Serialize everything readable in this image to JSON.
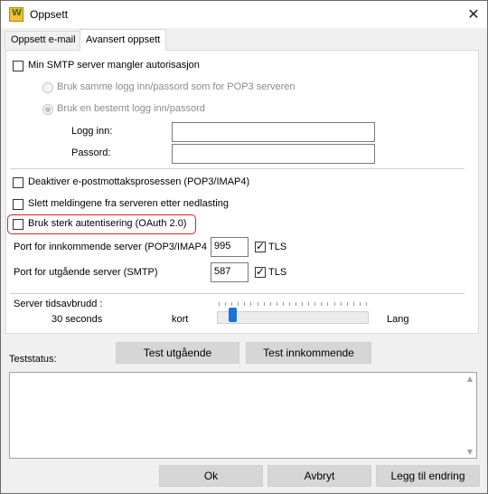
{
  "window": {
    "title": "Oppsett",
    "app_icon": "W",
    "close_glyph": "✕"
  },
  "tabs": [
    {
      "label": "Oppsett e-mail",
      "active": false
    },
    {
      "label": "Avansert oppsett",
      "active": true
    }
  ],
  "smtp": {
    "missing_auth_label": "Min SMTP server mangler autorisasjon",
    "missing_auth_checked": false,
    "same_login_label": "Bruk samme logg inn/passord som for POP3 serveren",
    "specific_login_label": "Bruk en bestemt logg inn/passord",
    "login_label": "Logg inn:",
    "login_value": "",
    "password_label": "Passord:",
    "password_value": ""
  },
  "options": {
    "disable_receive_label": "Deaktiver e-postmottaksprosessen (POP3/IMAP4)",
    "delete_messages_label": "Slett meldingene fra serveren etter nedlasting",
    "oauth_label": "Bruk sterk autentisering (OAuth 2.0)"
  },
  "ports": {
    "incoming_label": "Port for innkommende server (POP3/IMAP4",
    "incoming_value": "995",
    "incoming_tls_label": "TLS",
    "outgoing_label": "Port for utgående server (SMTP)",
    "outgoing_value": "587",
    "outgoing_tls_label": "TLS"
  },
  "timeout": {
    "label": "Server tidsavbrudd :",
    "value_text": "30 seconds",
    "short_label": "kort",
    "long_label": "Lang",
    "level_fraction": 0.07
  },
  "test": {
    "outgoing_button": "Test utgående",
    "incoming_button": "Test innkommende",
    "status_label": "Teststatus:",
    "status_text": ""
  },
  "footer": {
    "ok": "Ok",
    "cancel": "Avbryt",
    "add_change": "Legg til endring"
  },
  "colors": {
    "highlight": "#e02020",
    "slider_thumb": "#1a73d9",
    "checkbox_highlight": "#e02020"
  }
}
